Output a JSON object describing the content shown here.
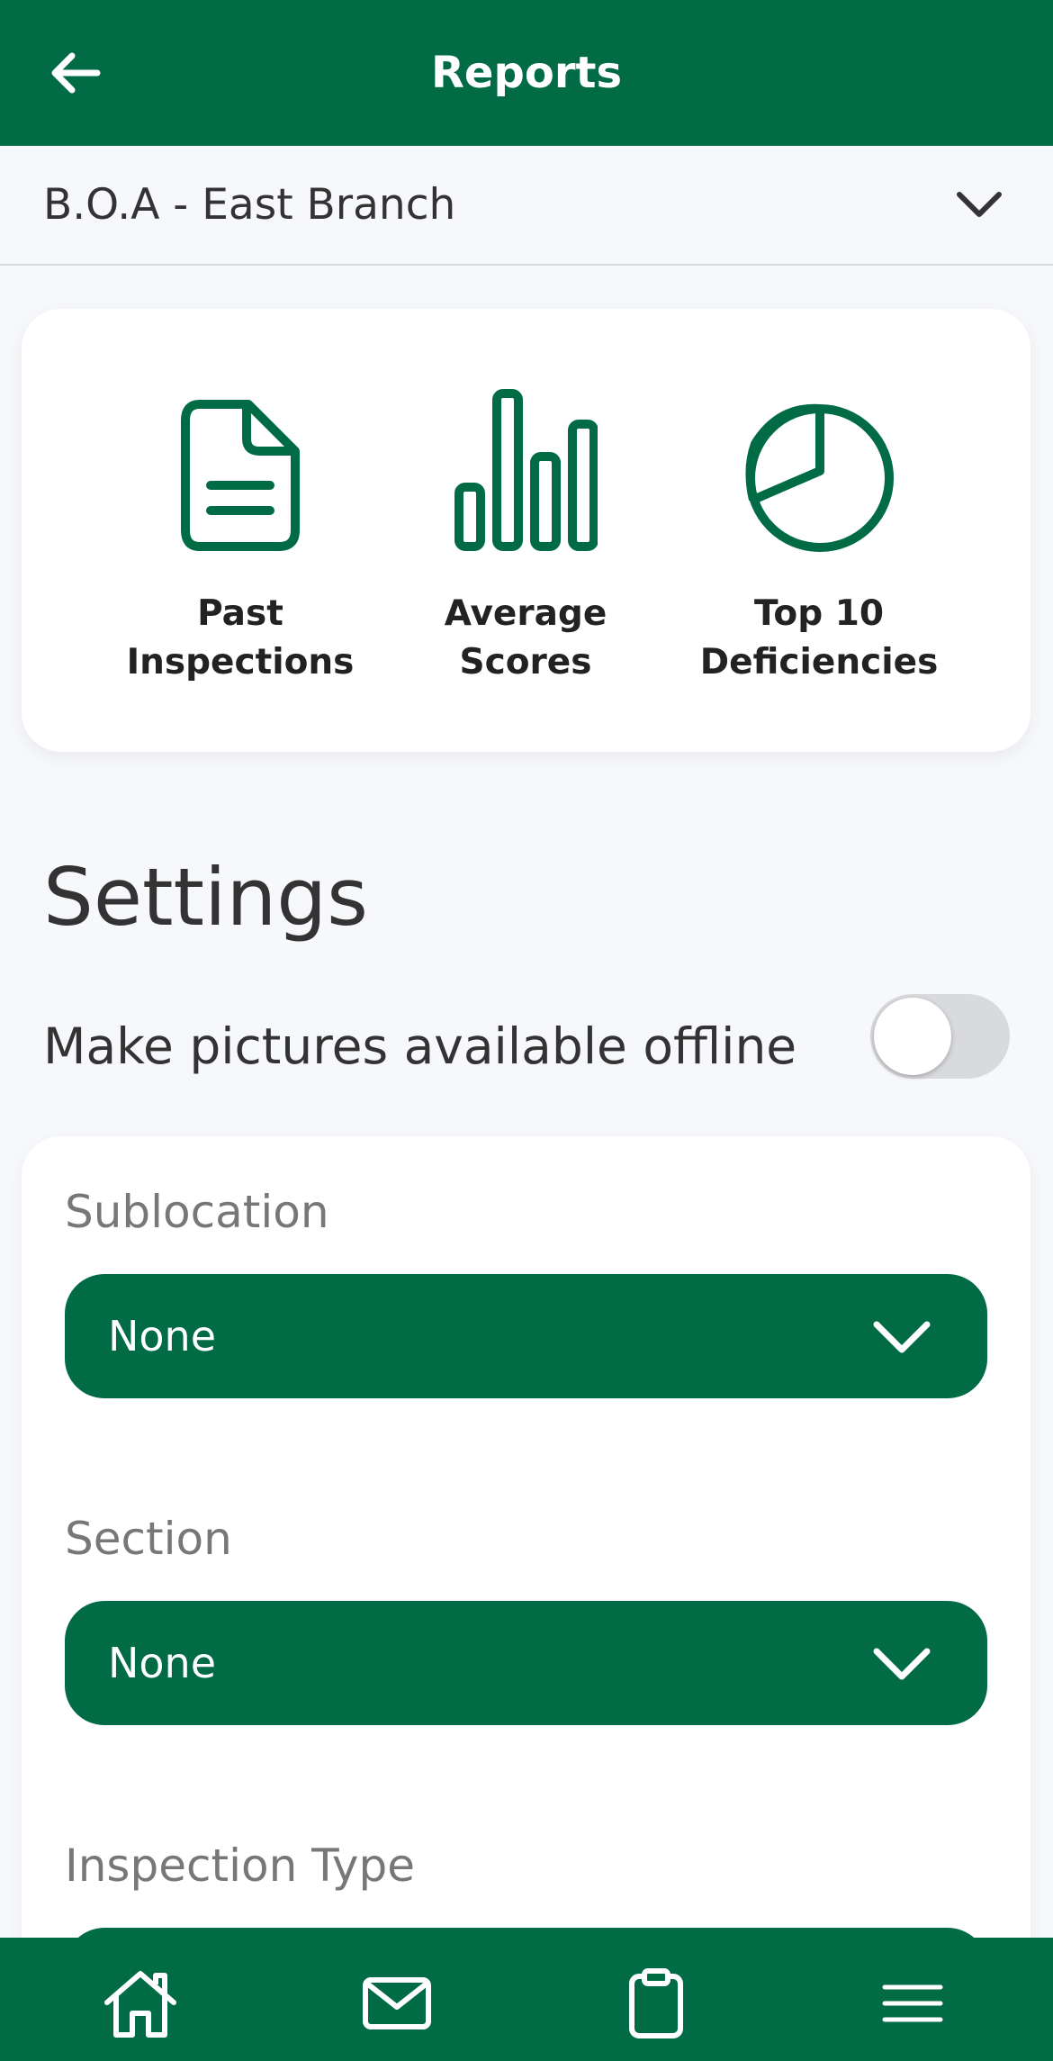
{
  "header": {
    "title": "Reports",
    "back_icon": "arrow-left-icon"
  },
  "branch": {
    "name": "B.O.A - East Branch",
    "icon": "chevron-down-icon"
  },
  "reports": [
    {
      "label_line1": "Past",
      "label_line2": "Inspections",
      "icon": "document-icon"
    },
    {
      "label_line1": "Average",
      "label_line2": "Scores",
      "icon": "bar-chart-icon"
    },
    {
      "label_line1": "Top 10",
      "label_line2": "Deficiencies",
      "icon": "pie-chart-icon"
    }
  ],
  "settings": {
    "title": "Settings",
    "offline_label": "Make pictures available offline",
    "offline_enabled": false
  },
  "filters": [
    {
      "label": "Sublocation",
      "value": "None"
    },
    {
      "label": "Section",
      "value": "None"
    },
    {
      "label": "Inspection Type",
      "value": ""
    }
  ],
  "nav": [
    {
      "name": "home",
      "icon": "home-icon"
    },
    {
      "name": "messages",
      "icon": "mail-icon"
    },
    {
      "name": "inspections",
      "icon": "clipboard-icon"
    },
    {
      "name": "menu",
      "icon": "hamburger-menu-icon"
    }
  ],
  "colors": {
    "brand": "#006b45",
    "background": "#f7f8fb",
    "toggle_off": "#d9dadd"
  }
}
